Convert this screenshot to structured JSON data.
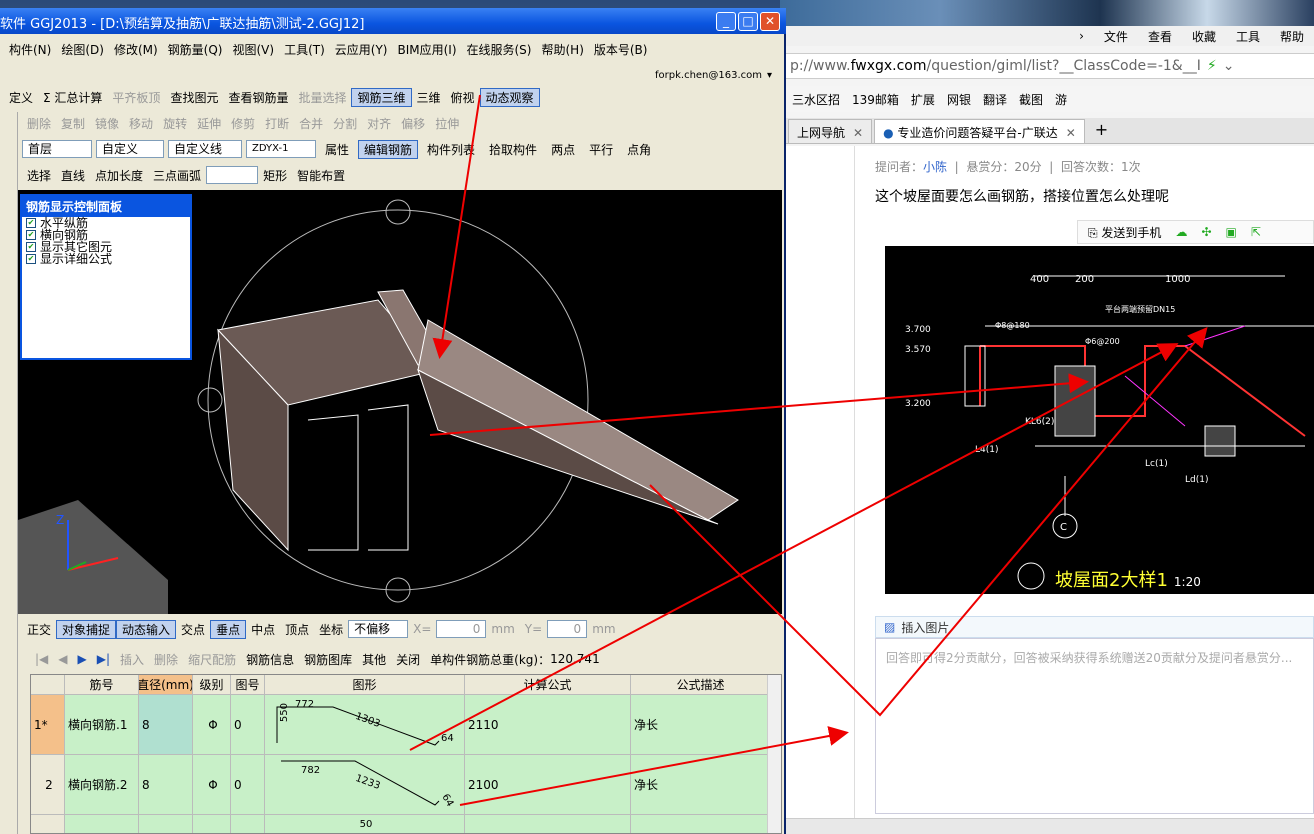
{
  "app": {
    "title": "软件 GGJ2013 - [D:\\预结算及抽筋\\广联达抽筋\\测试-2.GGJ12]",
    "menu": [
      "构件(N)",
      "绘图(D)",
      "修改(M)",
      "钢筋量(Q)",
      "视图(V)",
      "工具(T)",
      "云应用(Y)",
      "BIM应用(I)",
      "在线服务(S)",
      "帮助(H)",
      "版本号(B)"
    ],
    "account": "forpk.chen@163.com",
    "toolbar1": [
      "定义",
      "Σ 汇总计算",
      "平齐板顶",
      "查找图元",
      "查看钢筋量",
      "批量选择",
      "钢筋三维",
      "三维",
      "俯视",
      "动态观察"
    ],
    "toolbar2": [
      "删除",
      "复制",
      "镜像",
      "移动",
      "旋转",
      "延伸",
      "修剪",
      "打断",
      "合并",
      "分割",
      "对齐",
      "偏移",
      "拉伸"
    ],
    "toolbar3": {
      "floor": "首层",
      "def1": "自定义",
      "def2": "自定义线",
      "code": "ZDYX-1",
      "items": [
        "属性",
        "编辑钢筋",
        "构件列表",
        "拾取构件",
        "两点",
        "平行",
        "点角"
      ]
    },
    "toolbar4": [
      "选择",
      "直线",
      "点加长度",
      "三点画弧",
      "矩形",
      "智能布置"
    ],
    "panel": {
      "title": "钢筋显示控制面板",
      "items": [
        "水平纵筋",
        "横向钢筋",
        "显示其它图元",
        "显示详细公式"
      ]
    },
    "snapbar": {
      "items": [
        "正交",
        "对象捕捉",
        "动态输入",
        "交点",
        "垂点",
        "中点",
        "顶点",
        "坐标"
      ],
      "offset": "不偏移",
      "x_label": "X=",
      "x_val": "0",
      "unit1": "mm",
      "y_label": "Y=",
      "y_val": "0",
      "unit2": "mm"
    },
    "gridbar": {
      "items": [
        "插入",
        "删除",
        "缩尺配筋",
        "钢筋信息",
        "钢筋图库",
        "其他",
        "关闭"
      ],
      "total_label": "单构件钢筋总重(kg)：",
      "total": "120.741"
    },
    "table": {
      "headers": [
        "",
        "筋号",
        "直径(mm)",
        "级别",
        "图号",
        "图形",
        "计算公式",
        "公式描述"
      ],
      "rows": [
        {
          "idx": "1*",
          "name": "横向钢筋.1",
          "dia": "8",
          "grade": "Φ",
          "fig": "0",
          "s1": "550",
          "s2": "772",
          "s3": "1303",
          "s4": "64",
          "formula": "2110",
          "desc": "净长"
        },
        {
          "idx": "2",
          "name": "横向钢筋.2",
          "dia": "8",
          "grade": "Φ",
          "fig": "0",
          "s1": "",
          "s2": "782",
          "s3": "1233",
          "s4": "64",
          "formula": "2100",
          "desc": "净长"
        }
      ],
      "partial": "50"
    }
  },
  "browser": {
    "menu": [
      "文件",
      "查看",
      "收藏",
      "工具",
      "帮助"
    ],
    "url_prefix": "p://www.",
    "url_domain": "fwxgx.com",
    "url_rest": "/question/giml/list?__ClassCode=-1&__I",
    "favs": [
      "三水区招",
      "139邮箱",
      "扩展",
      "网银",
      "翻译",
      "截图",
      "游"
    ],
    "tabs": [
      "上网导航",
      "专业造价问题答疑平台-广联达"
    ],
    "meta": {
      "asker_label": "提问者：",
      "asker": "小陈",
      "reward": "悬赏分：20分",
      "answers": "回答次数：1次"
    },
    "question": "这个坡屋面要怎么画钢筋，搭接位置怎么处理呢",
    "send": "发送到手机",
    "cad": {
      "title": "坡屋面2大样1",
      "scale": "1:20",
      "dims": [
        "400",
        "200",
        "1000"
      ],
      "labels": [
        "3.700",
        "3.570",
        "3.200",
        "KL6(2)",
        "L4(1)",
        "Lc(1)",
        "Ld(1)",
        "平台两端预留DN15",
        "Φ8@180",
        "Φ6@200",
        "C"
      ]
    },
    "insert": "插入图片",
    "answer_placeholder": "回答即可得2分贡献分，回答被采纳获得系统赠送20贡献分及提问者悬赏分..."
  }
}
